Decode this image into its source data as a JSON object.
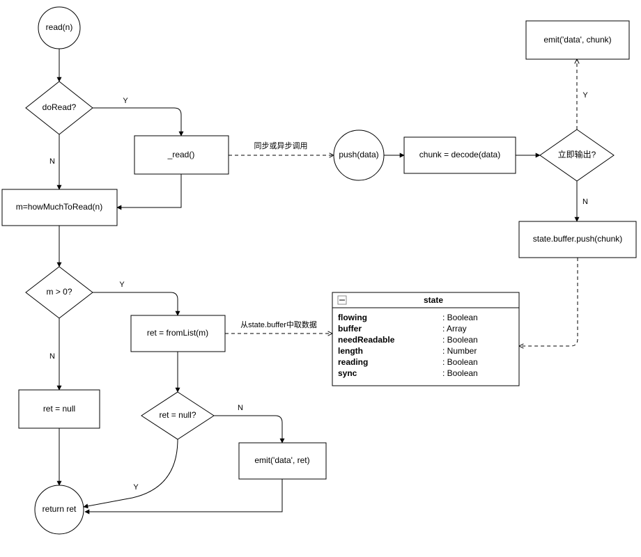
{
  "nodes": {
    "readn": "read(n)",
    "doRead": "doRead?",
    "readImpl": "_read()",
    "howMuch": "m=howMuchToRead(n)",
    "mgt0": "m > 0?",
    "fromList": "ret = fromList(m)",
    "retNull": "ret = null",
    "retNullQ": "ret = null?",
    "emitRet": "emit('data', ret)",
    "returnRet": "return ret",
    "pushData": "push(data)",
    "decode": "chunk = decode(data)",
    "emitNow": "立即输出?",
    "emitChunk": "emit('data', chunk)",
    "bufferPush": "state.buffer.push(chunk)",
    "stateTitle": "state"
  },
  "stateFields": [
    {
      "name": "flowing",
      "type": "Boolean"
    },
    {
      "name": "buffer",
      "type": "Array"
    },
    {
      "name": "needReadable",
      "type": "Boolean"
    },
    {
      "name": "length",
      "type": "Number"
    },
    {
      "name": "reading",
      "type": "Boolean"
    },
    {
      "name": "sync",
      "type": "Boolean"
    }
  ],
  "edgeLabels": {
    "y": "Y",
    "n": "N",
    "syncOrAsync": "同步或异步调用",
    "fromBuffer": "从state.buffer中取数据"
  },
  "chart_data": {
    "type": "flowchart",
    "nodes": [
      {
        "id": "readn",
        "shape": "terminator",
        "label": "read(n)"
      },
      {
        "id": "doRead",
        "shape": "decision",
        "label": "doRead?"
      },
      {
        "id": "readImpl",
        "shape": "process",
        "label": "_read()"
      },
      {
        "id": "howMuch",
        "shape": "process",
        "label": "m=howMuchToRead(n)"
      },
      {
        "id": "mgt0",
        "shape": "decision",
        "label": "m > 0?"
      },
      {
        "id": "fromList",
        "shape": "process",
        "label": "ret = fromList(m)"
      },
      {
        "id": "retNull",
        "shape": "process",
        "label": "ret = null"
      },
      {
        "id": "retNullQ",
        "shape": "decision",
        "label": "ret = null?"
      },
      {
        "id": "emitRet",
        "shape": "process",
        "label": "emit('data', ret)"
      },
      {
        "id": "returnRet",
        "shape": "terminator",
        "label": "return ret"
      },
      {
        "id": "pushData",
        "shape": "terminator",
        "label": "push(data)"
      },
      {
        "id": "decode",
        "shape": "process",
        "label": "chunk = decode(data)"
      },
      {
        "id": "emitNow",
        "shape": "decision",
        "label": "立即输出?"
      },
      {
        "id": "emitChunk",
        "shape": "process",
        "label": "emit('data', chunk)"
      },
      {
        "id": "bufferPush",
        "shape": "process",
        "label": "state.buffer.push(chunk)"
      },
      {
        "id": "state",
        "shape": "data",
        "label": "state",
        "fields": {
          "flowing": "Boolean",
          "buffer": "Array",
          "needReadable": "Boolean",
          "length": "Number",
          "reading": "Boolean",
          "sync": "Boolean"
        }
      }
    ],
    "edges": [
      {
        "from": "readn",
        "to": "doRead"
      },
      {
        "from": "doRead",
        "to": "readImpl",
        "label": "Y"
      },
      {
        "from": "doRead",
        "to": "howMuch",
        "label": "N"
      },
      {
        "from": "readImpl",
        "to": "howMuch"
      },
      {
        "from": "readImpl",
        "to": "pushData",
        "label": "同步或异步调用",
        "style": "dashed"
      },
      {
        "from": "howMuch",
        "to": "mgt0"
      },
      {
        "from": "mgt0",
        "to": "fromList",
        "label": "Y"
      },
      {
        "from": "mgt0",
        "to": "retNull",
        "label": "N"
      },
      {
        "from": "fromList",
        "to": "retNullQ"
      },
      {
        "from": "fromList",
        "to": "state",
        "label": "从state.buffer中取数据",
        "style": "dashed"
      },
      {
        "from": "retNullQ",
        "to": "emitRet",
        "label": "N"
      },
      {
        "from": "retNullQ",
        "to": "returnRet",
        "label": "Y"
      },
      {
        "from": "retNull",
        "to": "returnRet"
      },
      {
        "from": "emitRet",
        "to": "returnRet"
      },
      {
        "from": "pushData",
        "to": "decode"
      },
      {
        "from": "decode",
        "to": "emitNow"
      },
      {
        "from": "emitNow",
        "to": "emitChunk",
        "label": "Y"
      },
      {
        "from": "emitNow",
        "to": "bufferPush",
        "label": "N"
      },
      {
        "from": "bufferPush",
        "to": "state",
        "style": "dashed"
      }
    ]
  }
}
